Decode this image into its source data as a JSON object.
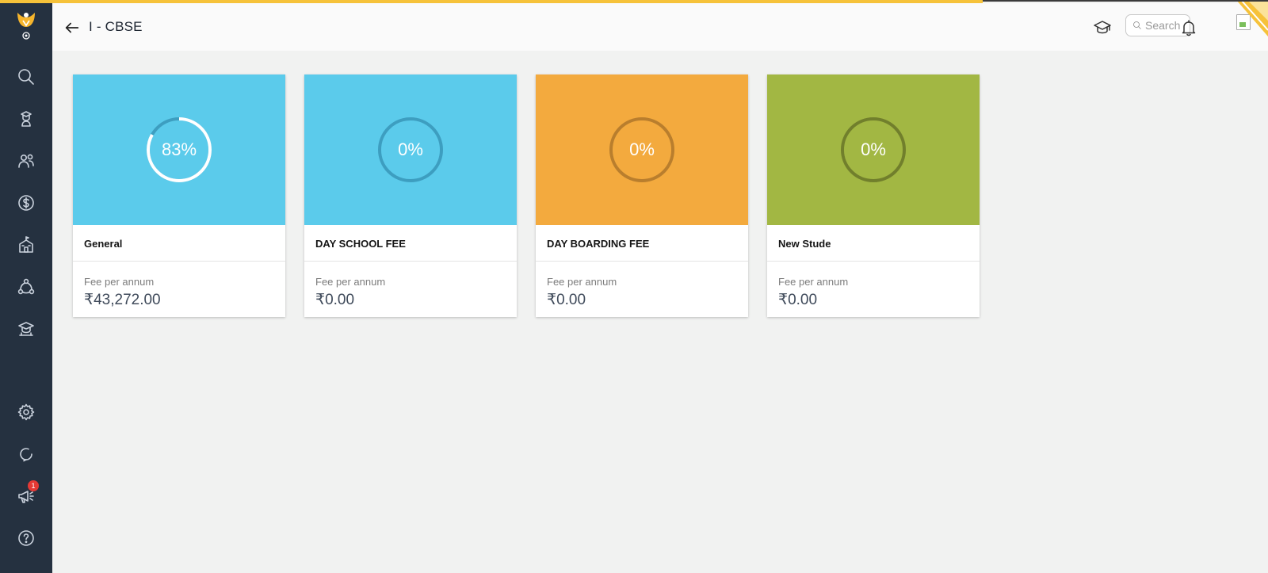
{
  "header": {
    "title": "I - CBSE",
    "search_placeholder": "Search"
  },
  "sidebar": {
    "items": [
      {
        "icon": "search-icon"
      },
      {
        "icon": "student-icon"
      },
      {
        "icon": "people-icon"
      },
      {
        "icon": "dollar-icon"
      },
      {
        "icon": "school-icon"
      },
      {
        "icon": "network-icon"
      },
      {
        "icon": "academy-icon"
      },
      {
        "icon": "settings-icon"
      },
      {
        "icon": "refresh-icon"
      },
      {
        "icon": "megaphone-icon",
        "badge": "1"
      },
      {
        "icon": "help-icon"
      }
    ]
  },
  "cards": [
    {
      "name": "General",
      "percent": 83,
      "percent_label": "83%",
      "fee_label": "Fee per annum",
      "fee_value": "₹43,272.00",
      "color": "#5bcbeb",
      "track": "#3d9ec0"
    },
    {
      "name": "DAY SCHOOL FEE",
      "percent": 0,
      "percent_label": "0%",
      "fee_label": "Fee per annum",
      "fee_value": "₹0.00",
      "color": "#5bcbeb",
      "track": "#3d9ec0"
    },
    {
      "name": "DAY BOARDING FEE",
      "percent": 0,
      "percent_label": "0%",
      "fee_label": "Fee per annum",
      "fee_value": "₹0.00",
      "color": "#f3aa3e",
      "track": "#b97e2d"
    },
    {
      "name": "New Stude",
      "percent": 0,
      "percent_label": "0%",
      "fee_label": "Fee per annum",
      "fee_value": "₹0.00",
      "color": "#a2b743",
      "track": "#717f2c"
    }
  ],
  "colors": {
    "sidebar_bg": "#253140",
    "accent_yellow": "#f6c23a",
    "badge_red": "#e53935"
  }
}
